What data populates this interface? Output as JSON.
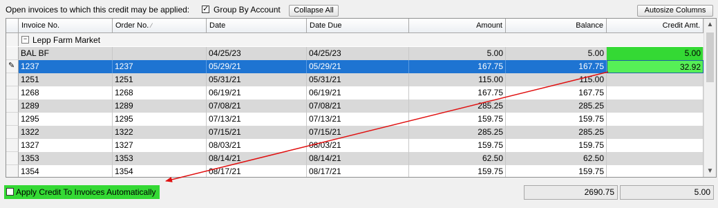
{
  "toolbar": {
    "caption": "Open invoices to which this credit may be applied:",
    "group_by_label": "Group By Account",
    "group_by_checked": true,
    "collapse_label": "Collapse All",
    "autosize_label": "Autosize Columns"
  },
  "grid": {
    "columns": [
      "Invoice No.",
      "Order No.",
      "Date",
      "Date Due",
      "Amount",
      "Balance",
      "Credit Amt."
    ],
    "group": {
      "expander": "−",
      "label": "Lepp Farm Market"
    },
    "rows": [
      {
        "inv": "BAL BF",
        "order": "",
        "date": "04/25/23",
        "due": "04/25/23",
        "amount": "5.00",
        "balance": "5.00",
        "credit": "5.00"
      },
      {
        "inv": "1237",
        "order": "1237",
        "date": "05/29/21",
        "due": "05/29/21",
        "amount": "167.75",
        "balance": "167.75",
        "credit": "32.92"
      },
      {
        "inv": "1251",
        "order": "1251",
        "date": "05/31/21",
        "due": "05/31/21",
        "amount": "115.00",
        "balance": "115.00",
        "credit": ""
      },
      {
        "inv": "1268",
        "order": "1268",
        "date": "06/19/21",
        "due": "06/19/21",
        "amount": "167.75",
        "balance": "167.75",
        "credit": ""
      },
      {
        "inv": "1289",
        "order": "1289",
        "date": "07/08/21",
        "due": "07/08/21",
        "amount": "285.25",
        "balance": "285.25",
        "credit": ""
      },
      {
        "inv": "1295",
        "order": "1295",
        "date": "07/13/21",
        "due": "07/13/21",
        "amount": "159.75",
        "balance": "159.75",
        "credit": ""
      },
      {
        "inv": "1322",
        "order": "1322",
        "date": "07/15/21",
        "due": "07/15/21",
        "amount": "285.25",
        "balance": "285.25",
        "credit": ""
      },
      {
        "inv": "1327",
        "order": "1327",
        "date": "08/03/21",
        "due": "08/03/21",
        "amount": "159.75",
        "balance": "159.75",
        "credit": ""
      },
      {
        "inv": "1353",
        "order": "1353",
        "date": "08/14/21",
        "due": "08/14/21",
        "amount": "62.50",
        "balance": "62.50",
        "credit": ""
      },
      {
        "inv": "1354",
        "order": "1354",
        "date": "08/17/21",
        "due": "08/17/21",
        "amount": "159.75",
        "balance": "159.75",
        "credit": ""
      }
    ]
  },
  "footer": {
    "auto_apply_label": "Apply Credit To Invoices Automatically",
    "auto_apply_checked": false,
    "balance_total": "2690.75",
    "credit_total": "5.00"
  },
  "colors": {
    "highlight_green": "#34d934",
    "selection_blue": "#1e74d2",
    "annotation_red": "#e01010"
  },
  "icons": {
    "row_editing": "pencil-icon",
    "scroll_up": "chevron-up-icon",
    "scroll_down": "chevron-down-icon"
  }
}
